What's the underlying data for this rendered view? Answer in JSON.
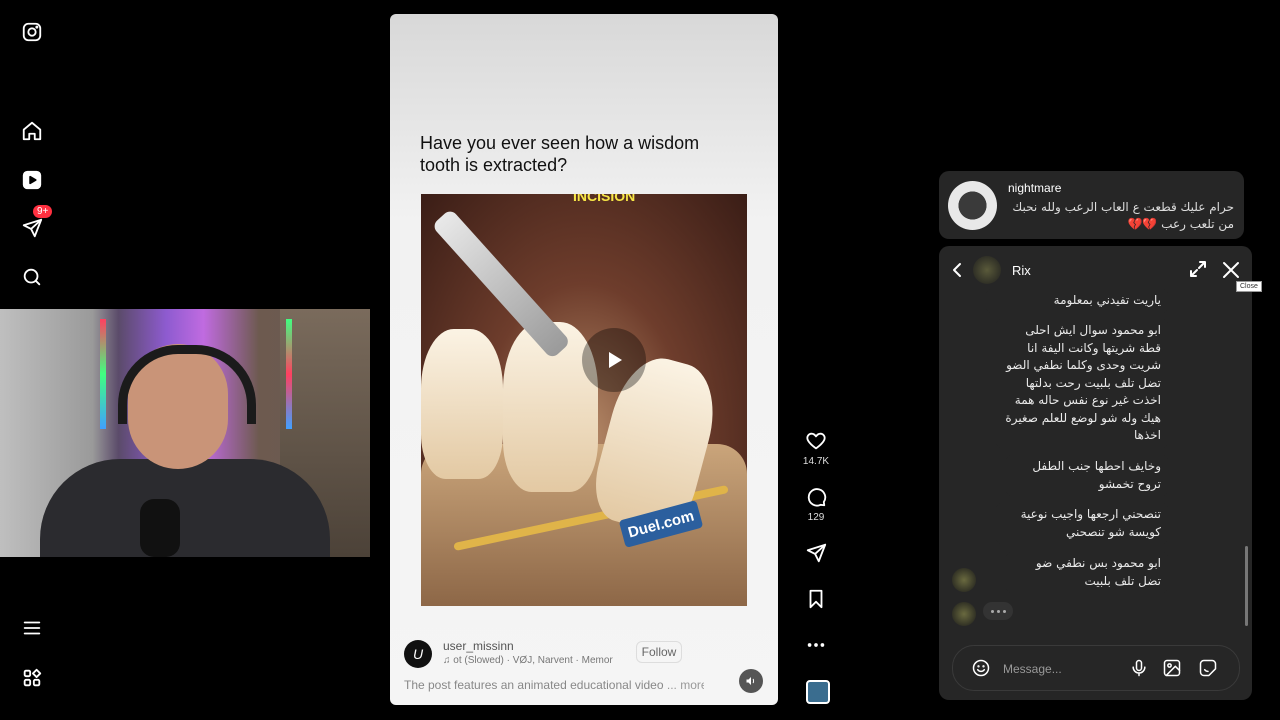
{
  "sidebar": {
    "items": [
      {
        "name": "instagram-logo-icon"
      },
      {
        "name": "home-icon"
      },
      {
        "name": "reels-icon"
      },
      {
        "name": "direct-icon",
        "badge": "9+"
      },
      {
        "name": "search-icon"
      },
      {
        "name": "more-menu-icon"
      },
      {
        "name": "also-from-meta-icon"
      }
    ]
  },
  "reel": {
    "title": "Have you ever seen how a wisdom tooth is extracted?",
    "image_label": "INCISION",
    "watermark": "Duel.com",
    "author": {
      "initial": "U",
      "username": "user_missinn"
    },
    "audio": "ot (Slowed) · VØJ, Narvent · Memory Reboot",
    "follow_label": "Follow",
    "caption": "The post features an animated educational video",
    "caption_more": "... more",
    "colors": {
      "title": "#111111",
      "label": "#f7e646"
    }
  },
  "actions": {
    "likes": "14.7K",
    "comments": "129"
  },
  "notification": {
    "name": "nightmare",
    "text": "حرام عليك قطعت ع العاب الرعب ولله نحبك من تلعب رعب 💔💔"
  },
  "chat": {
    "name": "Rix",
    "close_tooltip": "Close",
    "messages": [
      {
        "text": "ياريت تفيدني بمعلومة"
      },
      {
        "text": "ابو محمود سوال  ايش احلى قطة شريتها وكانت اليفة انا شريت وحدى وكلما نطفي الضو تضل تلف بلبيت رحت بدلتها اخذت غير نوع نفس حاله همة هيك وله شو لوضع للعلم صغيرة اخذها"
      },
      {
        "text": "وخايف احطها جنب الطفل تروح تخمشو"
      },
      {
        "text": "تنصحني ارجعها واجيب نوعية كويسة شو تنصحني"
      },
      {
        "text": "ابو محمود بس نطفي ضو تضل تلف بلبيت"
      }
    ],
    "placeholder": "Message..."
  }
}
